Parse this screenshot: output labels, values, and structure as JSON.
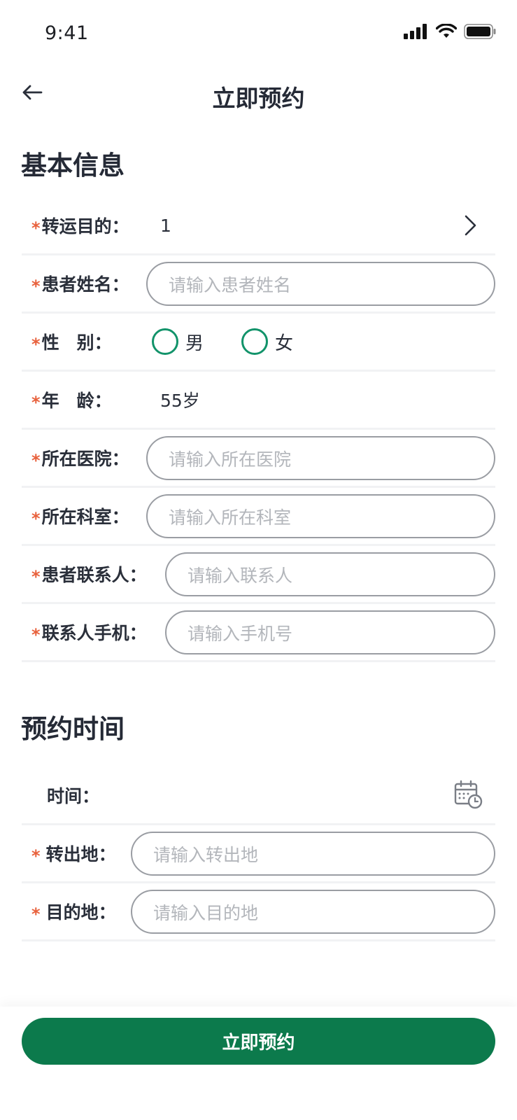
{
  "status_bar": {
    "time": "9:41"
  },
  "header": {
    "title": "立即预约"
  },
  "basic_info": {
    "section_title": "基本信息",
    "transfer_purpose": {
      "label": "转运目的：",
      "value": "1"
    },
    "patient_name": {
      "label": "患者姓名：",
      "placeholder": "请输入患者姓名"
    },
    "gender": {
      "label": "性　别：",
      "options": [
        "男",
        "女"
      ]
    },
    "age": {
      "label": "年　龄：",
      "value": "55岁"
    },
    "hospital": {
      "label": "所在医院：",
      "placeholder": "请输入所在医院"
    },
    "department": {
      "label": "所在科室：",
      "placeholder": "请输入所在科室"
    },
    "contact": {
      "label": "患者联系人：",
      "placeholder": "请输入联系人"
    },
    "contact_phone": {
      "label": "联系人手机：",
      "placeholder": "请输入手机号"
    }
  },
  "schedule": {
    "section_title": "预约时间",
    "time": {
      "label": "时间："
    },
    "origin": {
      "label": "转出地：",
      "placeholder": "请输入转出地"
    },
    "destination": {
      "label": "目的地：",
      "placeholder": "请输入目的地"
    }
  },
  "footer": {
    "submit_label": "立即预约"
  },
  "colors": {
    "accent": "#0c7a4c",
    "radio": "#12936a",
    "required": "#e8613c"
  }
}
